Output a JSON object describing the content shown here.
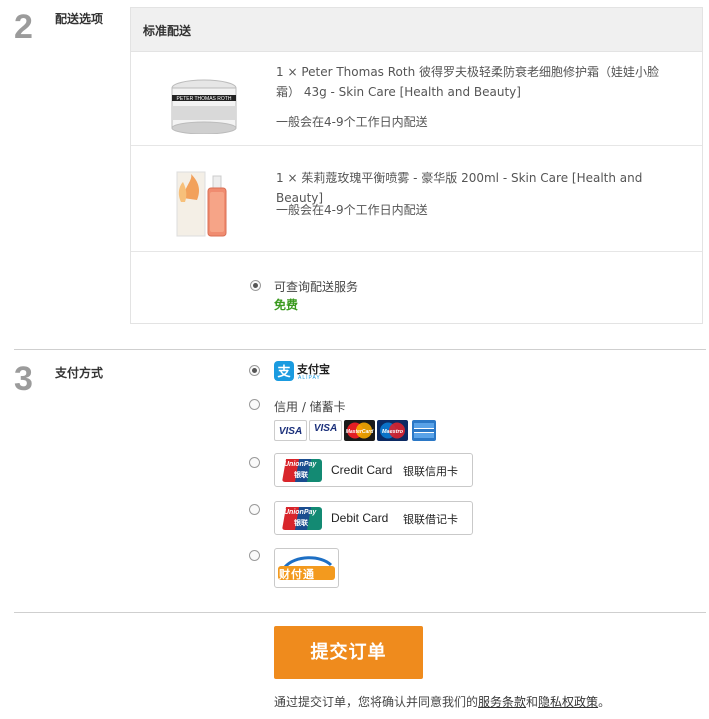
{
  "delivery": {
    "step_number": "2",
    "title": "配送选项",
    "header": "标准配送",
    "products": [
      {
        "name": "1 × Peter Thomas Roth 彼得罗夫极轻柔防衰老细胞修护霜（娃娃小脸霜） 43g - Skin Care [Health and Beauty]",
        "eta": "一般会在4-9个工作日内配送",
        "image_icon": "cream-jar-image"
      },
      {
        "name": "1 × 茱莉蔻玫瑰平衡喷雾 - 豪华版 200ml - Skin Care [Health and Beauty]",
        "eta": "一般会在4-9个工作日内配送",
        "image_icon": "spray-bottle-image"
      }
    ],
    "option_label": "可查询配送服务",
    "option_price": "免费",
    "price_color": "#3b9a1f"
  },
  "payment": {
    "step_number": "3",
    "title": "支付方式",
    "alipay": {
      "logo_cn": "支付宝",
      "logo_en": "ALIPAY",
      "color": "#1a9be0"
    },
    "card_label": "信用 / 储蓄卡",
    "card_brands": [
      "VISA",
      "VISA Electron",
      "MasterCard",
      "Maestro",
      "American Express"
    ],
    "unionpay_credit": {
      "logo_en": "UnionPay",
      "logo_cn": "银联",
      "label_en": "Credit Card",
      "label_cn": "银联信用卡"
    },
    "unionpay_debit": {
      "logo_en": "UnionPay",
      "logo_cn": "银联",
      "label_en": "Debit Card",
      "label_cn": "银联借记卡"
    },
    "tenpay": {
      "logo": "财付通"
    }
  },
  "submit": {
    "label": "提交订单",
    "color": "#ef8b1d",
    "terms_prefix": "通过提交订单，您将确认并同意我们的",
    "terms_link": "服务条款",
    "terms_and": "和",
    "privacy_link": "隐私权政策",
    "terms_suffix": "。"
  }
}
